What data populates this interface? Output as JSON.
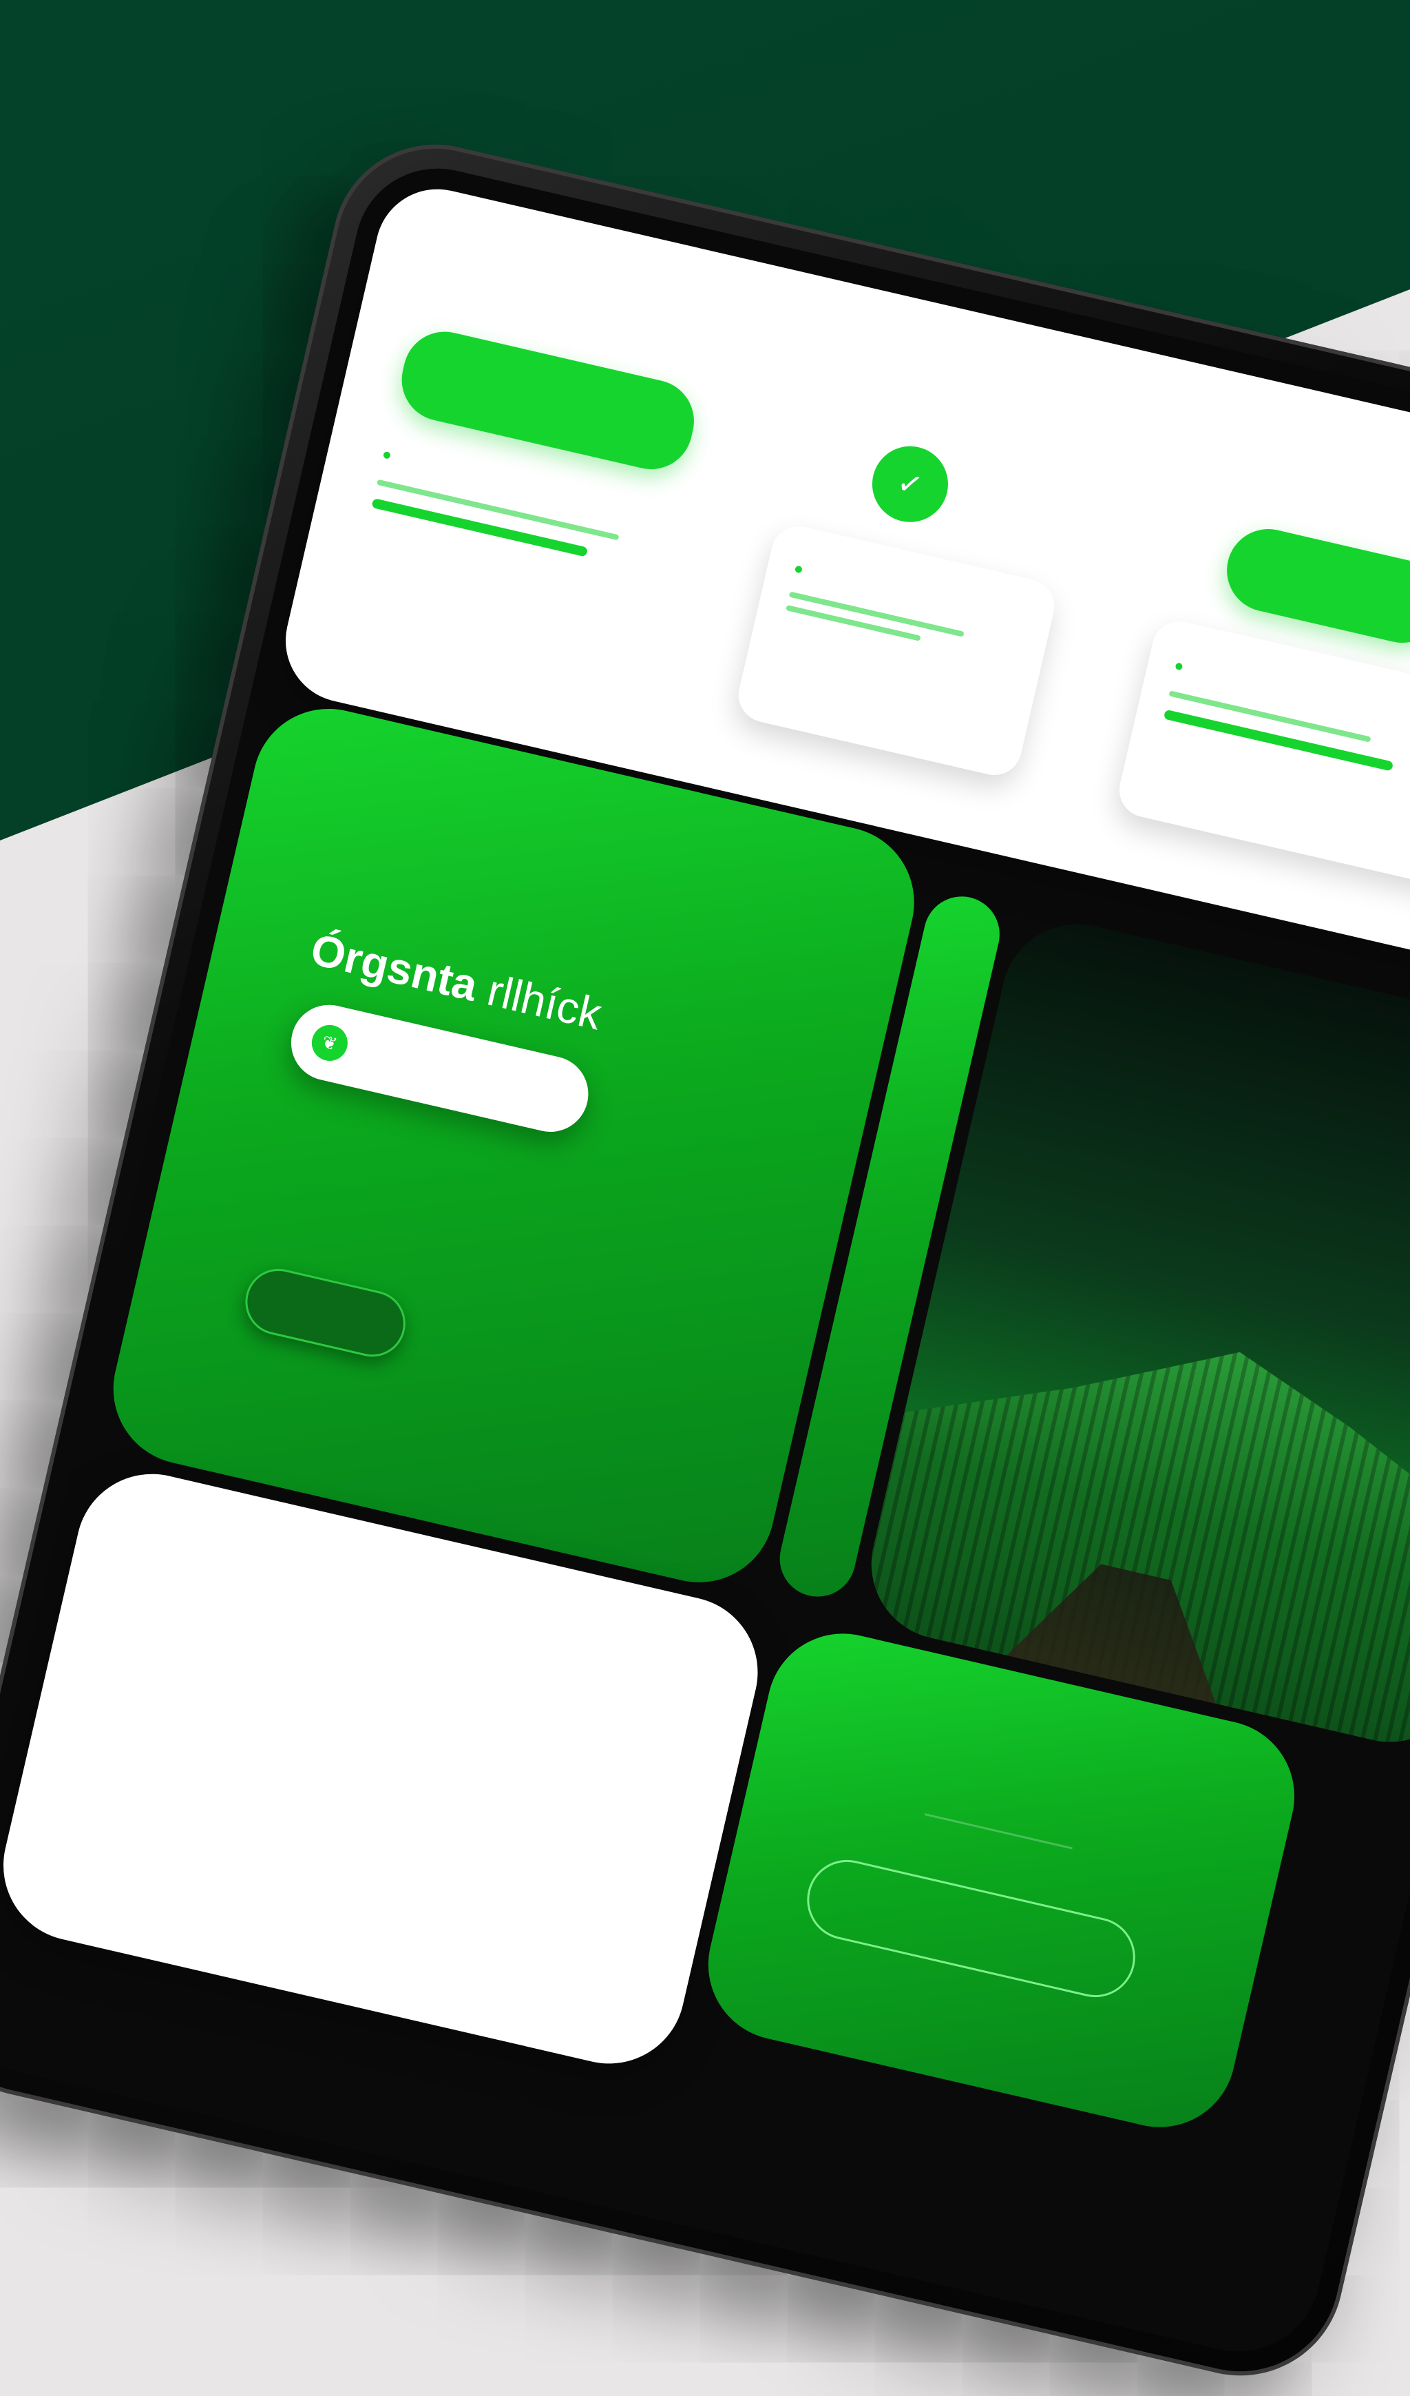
{
  "colors": {
    "accent_green": "#16d42e",
    "dark_green_bg": "#04432a",
    "device_black": "#0b0b0b",
    "brand_accent": "#d45b3a"
  },
  "header": {
    "brand_prefix": "",
    "brand_name": "",
    "nav_items": [
      "",
      "",
      "",
      "",
      "",
      "",
      "",
      ""
    ]
  },
  "top_cards": {
    "cta_button_label": "",
    "card1_title": "",
    "card2_title": "",
    "card3_button_label": "",
    "card3_title": ""
  },
  "hero": {
    "title_part1": "Órgsnta",
    "title_part2": "rllhíck",
    "search_text": "",
    "body_text": "",
    "button_label": ""
  },
  "forest_card": {
    "title": "",
    "caption": ""
  },
  "paper_card": {
    "title": "",
    "body_text": ""
  },
  "lower_green_card": {
    "title": "",
    "button_label": ""
  },
  "icons": [
    "check-icon",
    "leaf-icon"
  ]
}
